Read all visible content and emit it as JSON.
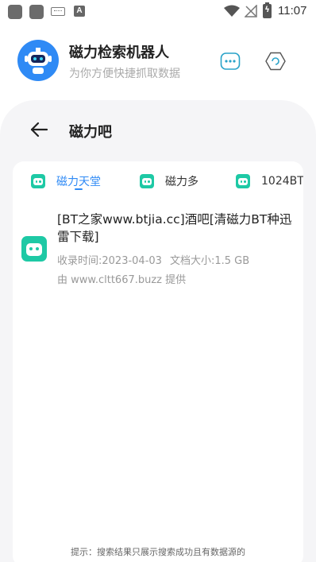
{
  "status_bar": {
    "time": "11:07",
    "battery_glyph": "ϟ",
    "keyboard_label": "A"
  },
  "app_header": {
    "title": "磁力检索机器人",
    "subtitle": "为你方便快捷抓取数据",
    "icons": [
      "robot-avatar-icon",
      "more-dots-icon",
      "hexagon-icon"
    ]
  },
  "page": {
    "title": "磁力吧",
    "back_icon": "arrow-left-icon"
  },
  "tabs": [
    {
      "label": "磁力天堂",
      "active": true
    },
    {
      "label": "磁力多",
      "active": false
    },
    {
      "label": "1024BT",
      "active": false
    }
  ],
  "results": [
    {
      "title": "[BT之家www.btjia.cc]酒吧[清磁力BT种迅雷下载]",
      "collected_label": "收录时间:2023-04-03",
      "size_label": "文档大小:1.5 GB",
      "source_label": "由 www.cltt667.buzz 提供"
    }
  ],
  "footer": {
    "tip": "提示：搜索结果只展示搜索成功且有数据源的"
  },
  "colors": {
    "accent": "#2f8af5",
    "bot_green": "#1ec9a5",
    "panel_bg": "#f5f5f7"
  }
}
